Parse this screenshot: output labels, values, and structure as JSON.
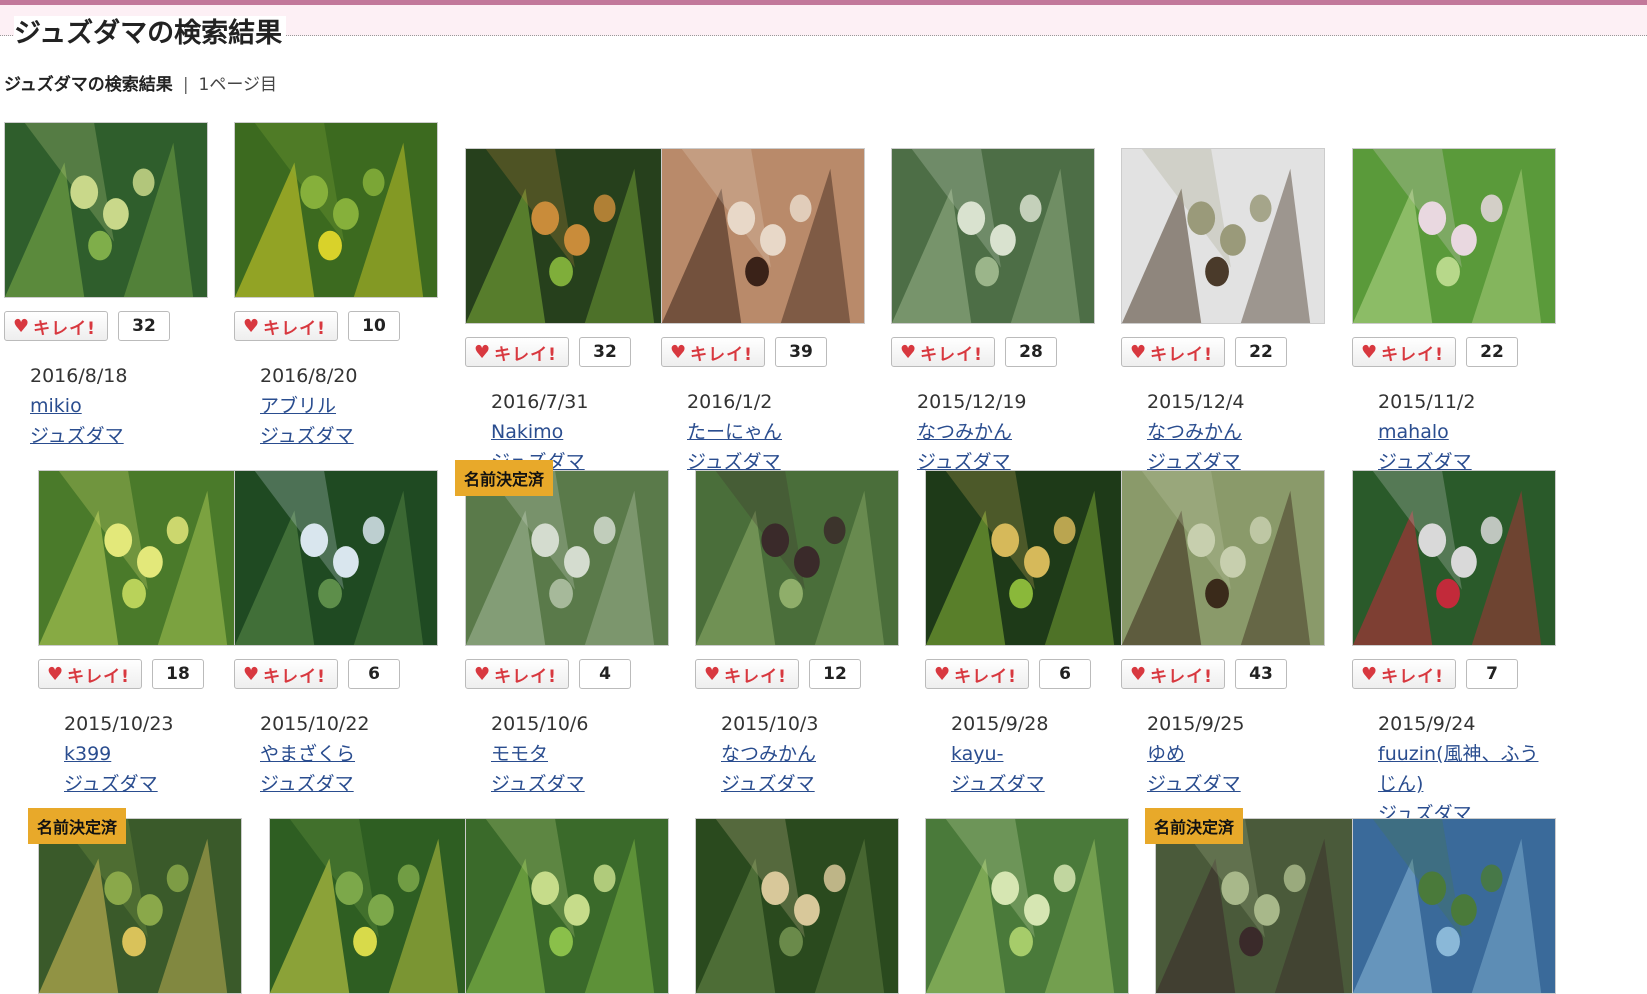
{
  "header": {
    "title": "ジュズダマの検索結果"
  },
  "subheader": {
    "label": "ジュズダマの検索結果",
    "separator": "|",
    "page": "1ページ目"
  },
  "like_label": "キレイ!",
  "badge_label": "名前決定済",
  "cards": [
    {
      "date": "2016/8/18",
      "user": "mikio",
      "plant": "ジュズダマ",
      "count": "32",
      "badge": "",
      "palette": [
        "#2f5e2c",
        "#7fae4a",
        "#c9d88a"
      ]
    },
    {
      "date": "2016/8/20",
      "user": "アブリル",
      "plant": "ジュズダマ",
      "count": "10",
      "badge": "",
      "palette": [
        "#3c6a1f",
        "#d9d22a",
        "#86b03b"
      ]
    },
    {
      "date": "2016/7/31",
      "user": "Nakimo",
      "plant": "ジュズダマ",
      "count": "32",
      "badge": "",
      "palette": [
        "#26401c",
        "#7fae3a",
        "#c98c3a"
      ]
    },
    {
      "date": "2016/1/2",
      "user": "たーにゃん",
      "plant": "ジュズダマ",
      "count": "39",
      "badge": "",
      "palette": [
        "#b98a6a",
        "#3a2218",
        "#e8d8c8"
      ]
    },
    {
      "date": "2015/12/19",
      "user": "なつみかん",
      "plant": "ジュズダマ",
      "count": "28",
      "badge": "",
      "palette": [
        "#4d6e46",
        "#9bb58a",
        "#d9e2cf"
      ]
    },
    {
      "date": "2015/12/4",
      "user": "なつみかん",
      "plant": "ジュズダマ",
      "count": "22",
      "badge": "",
      "palette": [
        "#e2e2e2",
        "#4a3a2a",
        "#9a9a7a"
      ]
    },
    {
      "date": "2015/11/2",
      "user": "mahalo",
      "plant": "ジュズダマ",
      "count": "22",
      "badge": "",
      "palette": [
        "#5a9a3a",
        "#b7d88a",
        "#e9d8e0"
      ]
    },
    {
      "date": "2015/10/23",
      "user": "k399",
      "plant": "ジュズダマ",
      "count": "18",
      "badge": "",
      "palette": [
        "#4a7a2a",
        "#b9d25a",
        "#e3e87a"
      ]
    },
    {
      "date": "2015/10/22",
      "user": "やまざくら",
      "plant": "ジュズダマ",
      "count": "6",
      "badge": "",
      "palette": [
        "#1f4a22",
        "#5d8e4a",
        "#d9e6ee"
      ]
    },
    {
      "date": "2015/10/6",
      "user": "モモタ",
      "plant": "ジュズダマ",
      "count": "4",
      "badge": "名前決定済",
      "palette": [
        "#5a7a4a",
        "#a6b99a",
        "#d4dccf"
      ]
    },
    {
      "date": "2015/10/3",
      "user": "なつみかん",
      "plant": "ジュズダマ",
      "count": "12",
      "badge": "",
      "palette": [
        "#4a6e3a",
        "#8fae6a",
        "#3a2a2a"
      ]
    },
    {
      "date": "2015/9/28",
      "user": "kayu-",
      "plant": "ジュズダマ",
      "count": "6",
      "badge": "",
      "palette": [
        "#1e3a18",
        "#8ab83a",
        "#d6b95a"
      ]
    },
    {
      "date": "2015/9/25",
      "user": "ゆめ",
      "plant": "ジュズダマ",
      "count": "43",
      "badge": "",
      "palette": [
        "#8a9a6a",
        "#3a2a1a",
        "#c7cfae"
      ]
    },
    {
      "date": "2015/9/24",
      "user": "fuuzin(風神、ふうじん)",
      "plant": "ジュズダマ",
      "count": "7",
      "badge": "",
      "palette": [
        "#2a5a2a",
        "#c22a3a",
        "#d9d9d9"
      ]
    },
    {
      "date": "",
      "user": "",
      "plant": "",
      "count": "",
      "badge": "名前決定済",
      "palette": [
        "#3a5a2a",
        "#d9c25a",
        "#8aa84a"
      ]
    },
    {
      "date": "",
      "user": "",
      "plant": "",
      "count": "",
      "badge": "",
      "palette": [
        "#2e5e22",
        "#d8da4a",
        "#7ca84a"
      ]
    },
    {
      "date": "",
      "user": "",
      "plant": "",
      "count": "",
      "badge": "",
      "palette": [
        "#3a6a2a",
        "#8ac04a",
        "#c6dc8a"
      ]
    },
    {
      "date": "",
      "user": "",
      "plant": "",
      "count": "",
      "badge": "",
      "palette": [
        "#2a4a1e",
        "#6a8a4a",
        "#d8c89a"
      ]
    },
    {
      "date": "",
      "user": "",
      "plant": "",
      "count": "",
      "badge": "",
      "palette": [
        "#4a7a3a",
        "#a6cc6a",
        "#d6e6b2"
      ]
    },
    {
      "date": "",
      "user": "",
      "plant": "",
      "count": "",
      "badge": "名前決定済",
      "palette": [
        "#4a5a3a",
        "#3a2a2a",
        "#a8b88a"
      ]
    },
    {
      "date": "",
      "user": "",
      "plant": "",
      "count": "",
      "badge": "",
      "palette": [
        "#3a6a9a",
        "#8ab8d8",
        "#4a7a3a"
      ]
    }
  ]
}
